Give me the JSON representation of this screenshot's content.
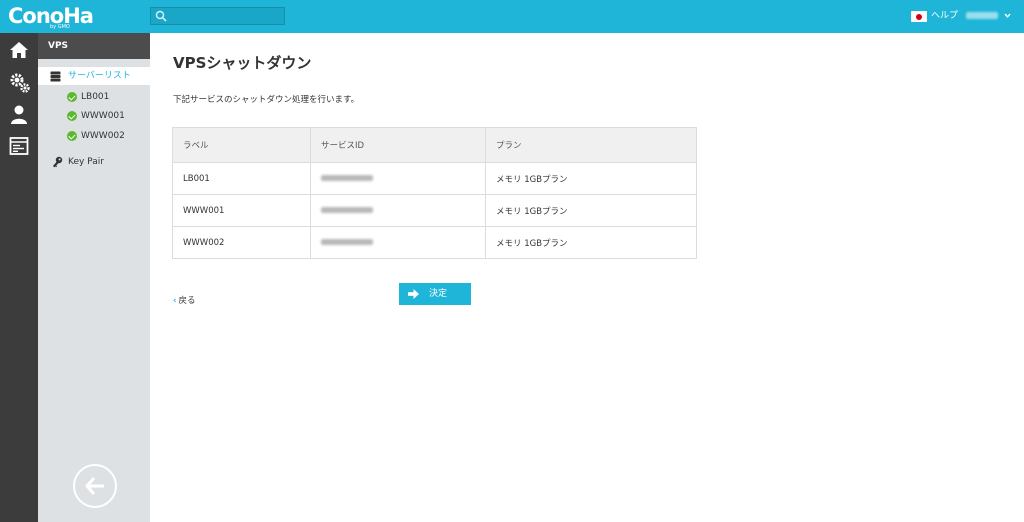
{
  "app": {
    "logo": "ConoHa",
    "logo_sub": "by GMO"
  },
  "header": {
    "search": {
      "value": "",
      "placeholder": ""
    },
    "help_label": "ヘルプ",
    "colors": {
      "bar": "#1fb5d8"
    }
  },
  "rail": {
    "items": [
      "home-icon",
      "gears-icon",
      "user-icon",
      "console-icon"
    ]
  },
  "sidebar": {
    "title": "VPS",
    "items": [
      {
        "label": "サーバーリスト",
        "icon": "server-icon",
        "active": true
      },
      {
        "label": "LB001",
        "icon": "check-circle-icon"
      },
      {
        "label": "WWW001",
        "icon": "check-circle-icon"
      },
      {
        "label": "WWW002",
        "icon": "check-circle-icon"
      },
      {
        "label": "Key Pair",
        "icon": "key-icon"
      }
    ]
  },
  "main": {
    "title": "VPSシャットダウン",
    "description": "下記サービスのシャットダウン処理を行います。",
    "table": {
      "headers": [
        "ラベル",
        "サービスID",
        "プラン"
      ],
      "rows": [
        {
          "label": "LB001",
          "plan": "メモリ 1GBプラン"
        },
        {
          "label": "WWW001",
          "plan": "メモリ 1GBプラン"
        },
        {
          "label": "WWW002",
          "plan": "メモリ 1GBプラン"
        }
      ]
    },
    "back_label": "戻る",
    "submit_label": "決定"
  }
}
